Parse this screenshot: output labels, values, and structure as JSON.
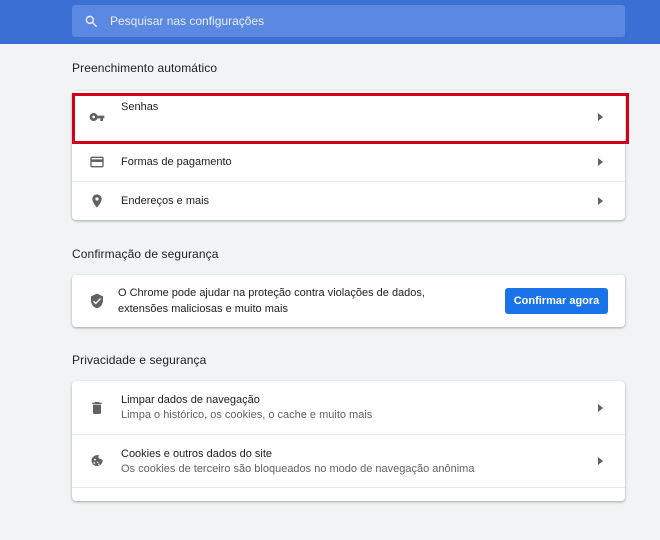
{
  "search": {
    "placeholder": "Pesquisar nas configurações"
  },
  "autofill": {
    "title": "Preenchimento automático",
    "items": [
      {
        "label": "Senhas",
        "icon": "key-icon"
      },
      {
        "label": "Formas de pagamento",
        "icon": "credit-card-icon"
      },
      {
        "label": "Endereços e mais",
        "icon": "location-pin-icon"
      }
    ]
  },
  "safety_check": {
    "title": "Confirmação de segurança",
    "description": "O Chrome pode ajudar na proteção contra violações de dados, extensões maliciosas e muito mais",
    "button_label": "Confirmar agora",
    "icon": "shield-check-icon"
  },
  "privacy": {
    "title": "Privacidade e segurança",
    "items": [
      {
        "label": "Limpar dados de navegação",
        "sublabel": "Limpa o histórico, os cookies, o cache e muito mais",
        "icon": "trash-icon"
      },
      {
        "label": "Cookies e outros dados do site",
        "sublabel": "Os cookies de terceiro são bloqueados no modo de navegação anônima",
        "icon": "cookie-icon"
      }
    ]
  },
  "colors": {
    "header": "#3c6fd3",
    "accent": "#1a73e8",
    "highlight": "#d0021b"
  }
}
